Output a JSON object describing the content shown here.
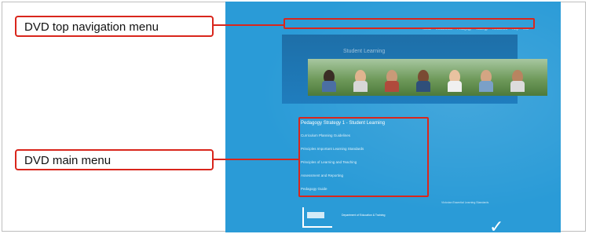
{
  "callouts": {
    "top_nav_label": "DVD top navigation menu",
    "main_menu_label": "DVD main menu"
  },
  "dvd": {
    "top_nav_items": [
      "Home",
      "Introduction",
      "Pedagogy",
      "Strategy",
      "Resources",
      "Help",
      "Exit"
    ],
    "site_title": "Student Learning",
    "main_menu": {
      "heading": "Pedagogy Strategy 1 - Student Learning",
      "items": [
        "Curriculum Planning Guidelines",
        "Principles Important Learning Standards",
        "Principles of Learning and Teaching",
        "Assessment and Reporting",
        "Pedagogy Guide"
      ]
    },
    "footer_left_text": "Department of Education & Training",
    "footer_right_text": "Victorian Essential Learning Standards"
  },
  "colors": {
    "screen_bg": "#2a9bd7",
    "highlight": "#d9261c"
  },
  "icons": {
    "footer_mark": "checkmark-logo-icon"
  }
}
